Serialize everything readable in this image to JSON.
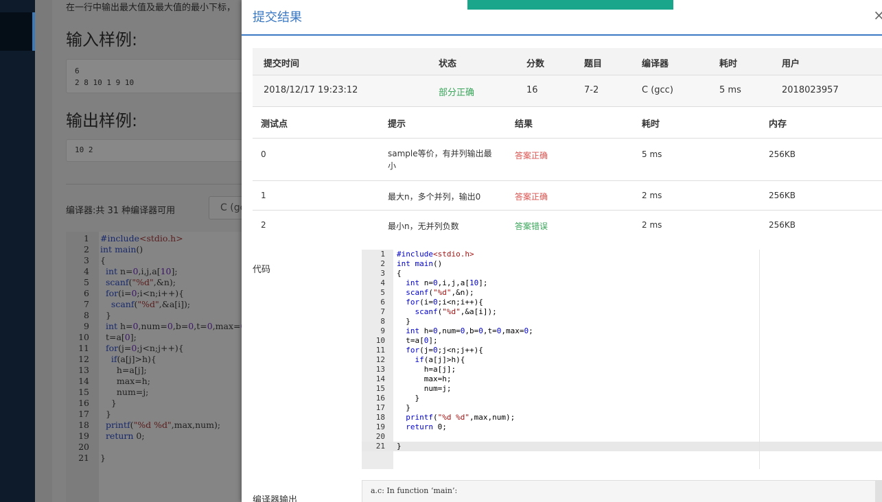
{
  "background": {
    "description_line": "在一行中输出最大值及最大值的最小下标，",
    "input_heading": "输入样例:",
    "input_sample": [
      "6",
      "2 8 10 1 9 10"
    ],
    "output_heading": "输出样例:",
    "output_sample": "10 2",
    "compiler_text": "编译器:共 31 种编译器可用",
    "compiler_select": "C (gc",
    "code_lines": [
      {
        "n": "1",
        "t": "#include<stdio.h>"
      },
      {
        "n": "2",
        "t": "int main()"
      },
      {
        "n": "3",
        "t": "{"
      },
      {
        "n": "4",
        "t": "  int n=0,i,j,a[10];"
      },
      {
        "n": "5",
        "t": "  scanf(\"%d\",&n);"
      },
      {
        "n": "6",
        "t": "  for(i=0;i<n;i++){"
      },
      {
        "n": "7",
        "t": "    scanf(\"%d\",&a[i]);"
      },
      {
        "n": "8",
        "t": "  }"
      },
      {
        "n": "9",
        "t": "  int h=0,num=0,b=0,t=0,max=0"
      },
      {
        "n": "10",
        "t": "  t=a[0];"
      },
      {
        "n": "11",
        "t": "  for(j=0;j<n;j++){"
      },
      {
        "n": "12",
        "t": "    if(a[j]>h){"
      },
      {
        "n": "13",
        "t": "      h=a[j];"
      },
      {
        "n": "14",
        "t": "      max=h;"
      },
      {
        "n": "15",
        "t": "      num=j;"
      },
      {
        "n": "16",
        "t": "    }"
      },
      {
        "n": "17",
        "t": "  }"
      },
      {
        "n": "18",
        "t": "  printf(\"%d %d\",max,num);"
      },
      {
        "n": "19",
        "t": "  return 0;"
      },
      {
        "n": "20",
        "t": ""
      },
      {
        "n": "21",
        "t": "}"
      }
    ]
  },
  "modal": {
    "title": "提交结果",
    "close": "×",
    "summary_headers": [
      "提交时间",
      "状态",
      "分数",
      "题目",
      "编译器",
      "耗时",
      "用户"
    ],
    "summary_values": [
      "2018/12/17 19:23:12",
      "部分正确",
      "16",
      "7-2",
      "C (gcc)",
      "5 ms",
      "2018023957"
    ],
    "tp_headers": [
      "测试点",
      "提示",
      "结果",
      "耗时",
      "内存"
    ],
    "tp_rows": [
      {
        "id": "0",
        "hint": "sample等价，有并列输出最小",
        "result": "答案正确",
        "time": "5 ms",
        "mem": "256KB"
      },
      {
        "id": "1",
        "hint": "最大n，多个并列，输出0",
        "result": "答案正确",
        "time": "2 ms",
        "mem": "256KB"
      },
      {
        "id": "2",
        "hint": "最小n，无并列负数",
        "result": "答案错误",
        "time": "2 ms",
        "mem": "256KB"
      }
    ],
    "code_label": "代码",
    "code_lines": [
      {
        "n": "1",
        "t": "#include<stdio.h>"
      },
      {
        "n": "2",
        "t": "int main()"
      },
      {
        "n": "3",
        "t": "{"
      },
      {
        "n": "4",
        "t": "  int n=0,i,j,a[10];"
      },
      {
        "n": "5",
        "t": "  scanf(\"%d\",&n);"
      },
      {
        "n": "6",
        "t": "  for(i=0;i<n;i++){"
      },
      {
        "n": "7",
        "t": "    scanf(\"%d\",&a[i]);"
      },
      {
        "n": "8",
        "t": "  }"
      },
      {
        "n": "9",
        "t": "  int h=0,num=0,b=0,t=0,max=0;"
      },
      {
        "n": "10",
        "t": "  t=a[0];"
      },
      {
        "n": "11",
        "t": "  for(j=0;j<n;j++){"
      },
      {
        "n": "12",
        "t": "    if(a[j]>h){"
      },
      {
        "n": "13",
        "t": "      h=a[j];"
      },
      {
        "n": "14",
        "t": "      max=h;"
      },
      {
        "n": "15",
        "t": "      num=j;"
      },
      {
        "n": "16",
        "t": "    }"
      },
      {
        "n": "17",
        "t": "  }"
      },
      {
        "n": "18",
        "t": "  printf(\"%d %d\",max,num);"
      },
      {
        "n": "19",
        "t": "  return 0;"
      },
      {
        "n": "20",
        "t": ""
      },
      {
        "n": "21",
        "t": "}"
      }
    ],
    "compiler_output_label": "编译器输出",
    "compiler_output_text": "a.c: In function ‘main’:"
  },
  "colors": {
    "accent": "#3a78c3",
    "toast": "#1aa68a",
    "correct": "#d9534f",
    "wrong": "#3aa55a"
  }
}
